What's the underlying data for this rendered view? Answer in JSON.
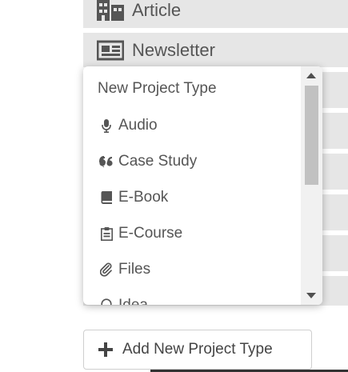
{
  "background_list": {
    "items": [
      {
        "label": "Article",
        "icon": "building-icon"
      },
      {
        "label": "Newsletter",
        "icon": "newspaper-icon"
      },
      {
        "label": "",
        "icon": ""
      },
      {
        "label": "",
        "icon": ""
      },
      {
        "label": "",
        "icon": ""
      },
      {
        "label": "",
        "icon": ""
      },
      {
        "label": "",
        "icon": ""
      },
      {
        "label": "",
        "icon": ""
      }
    ]
  },
  "dropdown": {
    "header": "New Project Type",
    "items": [
      {
        "label": "Audio",
        "icon": "microphone-icon"
      },
      {
        "label": "Case Study",
        "icon": "quote-icon"
      },
      {
        "label": "E-Book",
        "icon": "book-icon"
      },
      {
        "label": "E-Course",
        "icon": "clipboard-icon"
      },
      {
        "label": "Files",
        "icon": "paperclip-icon"
      },
      {
        "label": "Idea",
        "icon": "lightbulb-icon"
      }
    ]
  },
  "add_button": {
    "label": "Add New Project Type",
    "icon": "plus-icon"
  },
  "colors": {
    "row_background": "#e6e6e6",
    "text": "#555555",
    "scrollbar_track": "#f1f1f1",
    "scrollbar_thumb": "#c1c1c1"
  }
}
